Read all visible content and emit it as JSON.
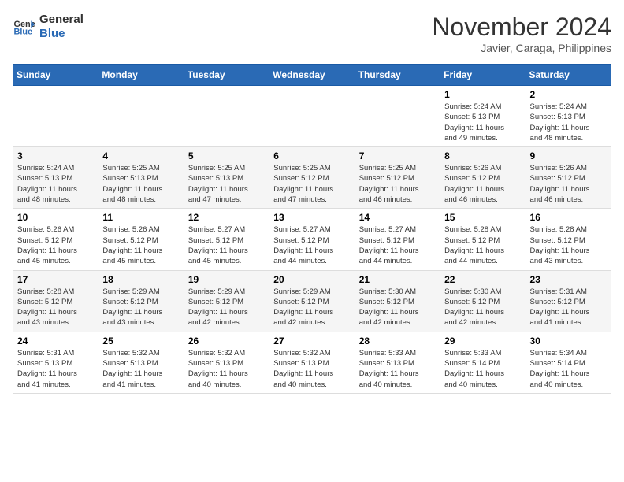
{
  "header": {
    "logo_line1": "General",
    "logo_line2": "Blue",
    "month": "November 2024",
    "location": "Javier, Caraga, Philippines"
  },
  "weekdays": [
    "Sunday",
    "Monday",
    "Tuesday",
    "Wednesday",
    "Thursday",
    "Friday",
    "Saturday"
  ],
  "weeks": [
    [
      {
        "day": "",
        "info": ""
      },
      {
        "day": "",
        "info": ""
      },
      {
        "day": "",
        "info": ""
      },
      {
        "day": "",
        "info": ""
      },
      {
        "day": "",
        "info": ""
      },
      {
        "day": "1",
        "info": "Sunrise: 5:24 AM\nSunset: 5:13 PM\nDaylight: 11 hours\nand 49 minutes."
      },
      {
        "day": "2",
        "info": "Sunrise: 5:24 AM\nSunset: 5:13 PM\nDaylight: 11 hours\nand 48 minutes."
      }
    ],
    [
      {
        "day": "3",
        "info": "Sunrise: 5:24 AM\nSunset: 5:13 PM\nDaylight: 11 hours\nand 48 minutes."
      },
      {
        "day": "4",
        "info": "Sunrise: 5:25 AM\nSunset: 5:13 PM\nDaylight: 11 hours\nand 48 minutes."
      },
      {
        "day": "5",
        "info": "Sunrise: 5:25 AM\nSunset: 5:13 PM\nDaylight: 11 hours\nand 47 minutes."
      },
      {
        "day": "6",
        "info": "Sunrise: 5:25 AM\nSunset: 5:12 PM\nDaylight: 11 hours\nand 47 minutes."
      },
      {
        "day": "7",
        "info": "Sunrise: 5:25 AM\nSunset: 5:12 PM\nDaylight: 11 hours\nand 46 minutes."
      },
      {
        "day": "8",
        "info": "Sunrise: 5:26 AM\nSunset: 5:12 PM\nDaylight: 11 hours\nand 46 minutes."
      },
      {
        "day": "9",
        "info": "Sunrise: 5:26 AM\nSunset: 5:12 PM\nDaylight: 11 hours\nand 46 minutes."
      }
    ],
    [
      {
        "day": "10",
        "info": "Sunrise: 5:26 AM\nSunset: 5:12 PM\nDaylight: 11 hours\nand 45 minutes."
      },
      {
        "day": "11",
        "info": "Sunrise: 5:26 AM\nSunset: 5:12 PM\nDaylight: 11 hours\nand 45 minutes."
      },
      {
        "day": "12",
        "info": "Sunrise: 5:27 AM\nSunset: 5:12 PM\nDaylight: 11 hours\nand 45 minutes."
      },
      {
        "day": "13",
        "info": "Sunrise: 5:27 AM\nSunset: 5:12 PM\nDaylight: 11 hours\nand 44 minutes."
      },
      {
        "day": "14",
        "info": "Sunrise: 5:27 AM\nSunset: 5:12 PM\nDaylight: 11 hours\nand 44 minutes."
      },
      {
        "day": "15",
        "info": "Sunrise: 5:28 AM\nSunset: 5:12 PM\nDaylight: 11 hours\nand 44 minutes."
      },
      {
        "day": "16",
        "info": "Sunrise: 5:28 AM\nSunset: 5:12 PM\nDaylight: 11 hours\nand 43 minutes."
      }
    ],
    [
      {
        "day": "17",
        "info": "Sunrise: 5:28 AM\nSunset: 5:12 PM\nDaylight: 11 hours\nand 43 minutes."
      },
      {
        "day": "18",
        "info": "Sunrise: 5:29 AM\nSunset: 5:12 PM\nDaylight: 11 hours\nand 43 minutes."
      },
      {
        "day": "19",
        "info": "Sunrise: 5:29 AM\nSunset: 5:12 PM\nDaylight: 11 hours\nand 42 minutes."
      },
      {
        "day": "20",
        "info": "Sunrise: 5:29 AM\nSunset: 5:12 PM\nDaylight: 11 hours\nand 42 minutes."
      },
      {
        "day": "21",
        "info": "Sunrise: 5:30 AM\nSunset: 5:12 PM\nDaylight: 11 hours\nand 42 minutes."
      },
      {
        "day": "22",
        "info": "Sunrise: 5:30 AM\nSunset: 5:12 PM\nDaylight: 11 hours\nand 42 minutes."
      },
      {
        "day": "23",
        "info": "Sunrise: 5:31 AM\nSunset: 5:12 PM\nDaylight: 11 hours\nand 41 minutes."
      }
    ],
    [
      {
        "day": "24",
        "info": "Sunrise: 5:31 AM\nSunset: 5:13 PM\nDaylight: 11 hours\nand 41 minutes."
      },
      {
        "day": "25",
        "info": "Sunrise: 5:32 AM\nSunset: 5:13 PM\nDaylight: 11 hours\nand 41 minutes."
      },
      {
        "day": "26",
        "info": "Sunrise: 5:32 AM\nSunset: 5:13 PM\nDaylight: 11 hours\nand 40 minutes."
      },
      {
        "day": "27",
        "info": "Sunrise: 5:32 AM\nSunset: 5:13 PM\nDaylight: 11 hours\nand 40 minutes."
      },
      {
        "day": "28",
        "info": "Sunrise: 5:33 AM\nSunset: 5:13 PM\nDaylight: 11 hours\nand 40 minutes."
      },
      {
        "day": "29",
        "info": "Sunrise: 5:33 AM\nSunset: 5:14 PM\nDaylight: 11 hours\nand 40 minutes."
      },
      {
        "day": "30",
        "info": "Sunrise: 5:34 AM\nSunset: 5:14 PM\nDaylight: 11 hours\nand 40 minutes."
      }
    ]
  ]
}
